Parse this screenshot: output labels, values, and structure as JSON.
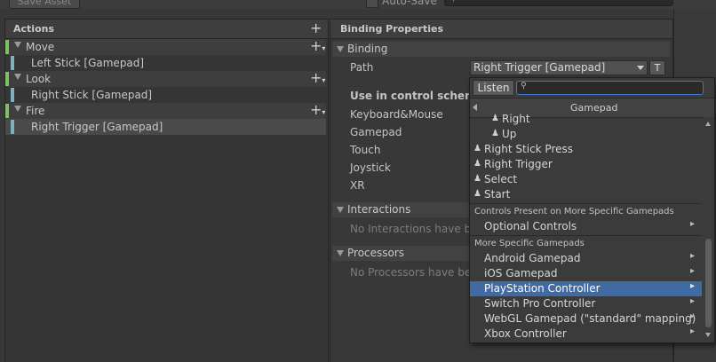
{
  "toolbar": {
    "save_asset_label": "Save Asset",
    "auto_save_label": "Auto-Save"
  },
  "actions": {
    "title": "Actions",
    "items": [
      {
        "name": "Move",
        "bindings": [
          "Left Stick [Gamepad]"
        ]
      },
      {
        "name": "Look",
        "bindings": [
          "Right Stick [Gamepad]"
        ]
      },
      {
        "name": "Fire",
        "bindings": [
          "Right Trigger [Gamepad]"
        ]
      }
    ]
  },
  "binding_properties": {
    "title": "Binding Properties",
    "binding_section": "Binding",
    "path_label": "Path",
    "path_value": "Right Trigger [Gamepad]",
    "t_button": "T",
    "use_in_scheme_label": "Use in control scheme",
    "schemes": [
      "Keyboard&Mouse",
      "Gamepad",
      "Touch",
      "Joystick",
      "XR"
    ],
    "interactions_section": "Interactions",
    "interactions_empty": "No Interactions have bee",
    "processors_section": "Processors",
    "processors_empty": "No Processors have bee"
  },
  "dropdown": {
    "listen_label": "Listen",
    "search_value": "",
    "header_title": "Gamepad",
    "controls": [
      "Right",
      "Up",
      "Right Stick Press",
      "Right Trigger",
      "Select",
      "Start"
    ],
    "group1_title": "Controls Present on More Specific Gamepads",
    "group1_items": [
      "Optional Controls"
    ],
    "group2_title": "More Specific Gamepads",
    "group2_items": [
      "Android Gamepad",
      "iOS Gamepad",
      "PlayStation Controller",
      "Switch Pro Controller",
      "WebGL Gamepad (\"standard\" mapping)",
      "Xbox Controller"
    ],
    "highlighted": "PlayStation Controller"
  },
  "colors": {
    "action_strip": "#7fbf67",
    "binding_strip": "#7fb2b8",
    "highlight": "#3f6aa3",
    "search_focus": "#3d76c4"
  },
  "icons": {
    "control": "person-icon",
    "submenu": "chevron-right-icon"
  }
}
